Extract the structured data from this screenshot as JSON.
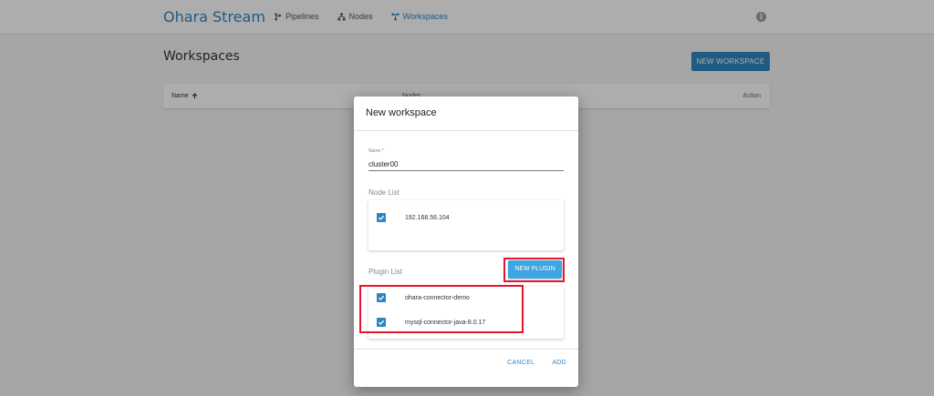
{
  "app": {
    "brand": "Ohara Stream"
  },
  "nav": {
    "items": [
      {
        "label": "Pipelines",
        "icon": "pipelines-icon",
        "active": false
      },
      {
        "label": "Nodes",
        "icon": "nodes-icon",
        "active": false
      },
      {
        "label": "Workspaces",
        "icon": "workspaces-icon",
        "active": true
      }
    ]
  },
  "page": {
    "title": "Workspaces",
    "new_workspace_label": "NEW WORKSPACE",
    "table": {
      "columns": [
        "Name",
        "Nodes",
        "Action"
      ],
      "sort_column": "Name",
      "sort_direction": "ascending"
    }
  },
  "dialog": {
    "title": "New workspace",
    "name_field": {
      "label": "Name *",
      "value": "cluster00"
    },
    "node_list": {
      "label": "Node List",
      "items": [
        {
          "label": "192.168.56.104",
          "checked": true
        }
      ]
    },
    "plugin_list": {
      "label": "Plugin List",
      "new_plugin_label": "NEW PLUGIN",
      "items": [
        {
          "label": "ohara-connector-demo",
          "checked": true
        },
        {
          "label": "mysql-connector-java-8.0.17",
          "checked": true
        }
      ]
    },
    "actions": {
      "cancel": "CANCEL",
      "add": "ADD"
    }
  },
  "colors": {
    "accent": "#2e86c1",
    "highlight": "#e8152a"
  }
}
